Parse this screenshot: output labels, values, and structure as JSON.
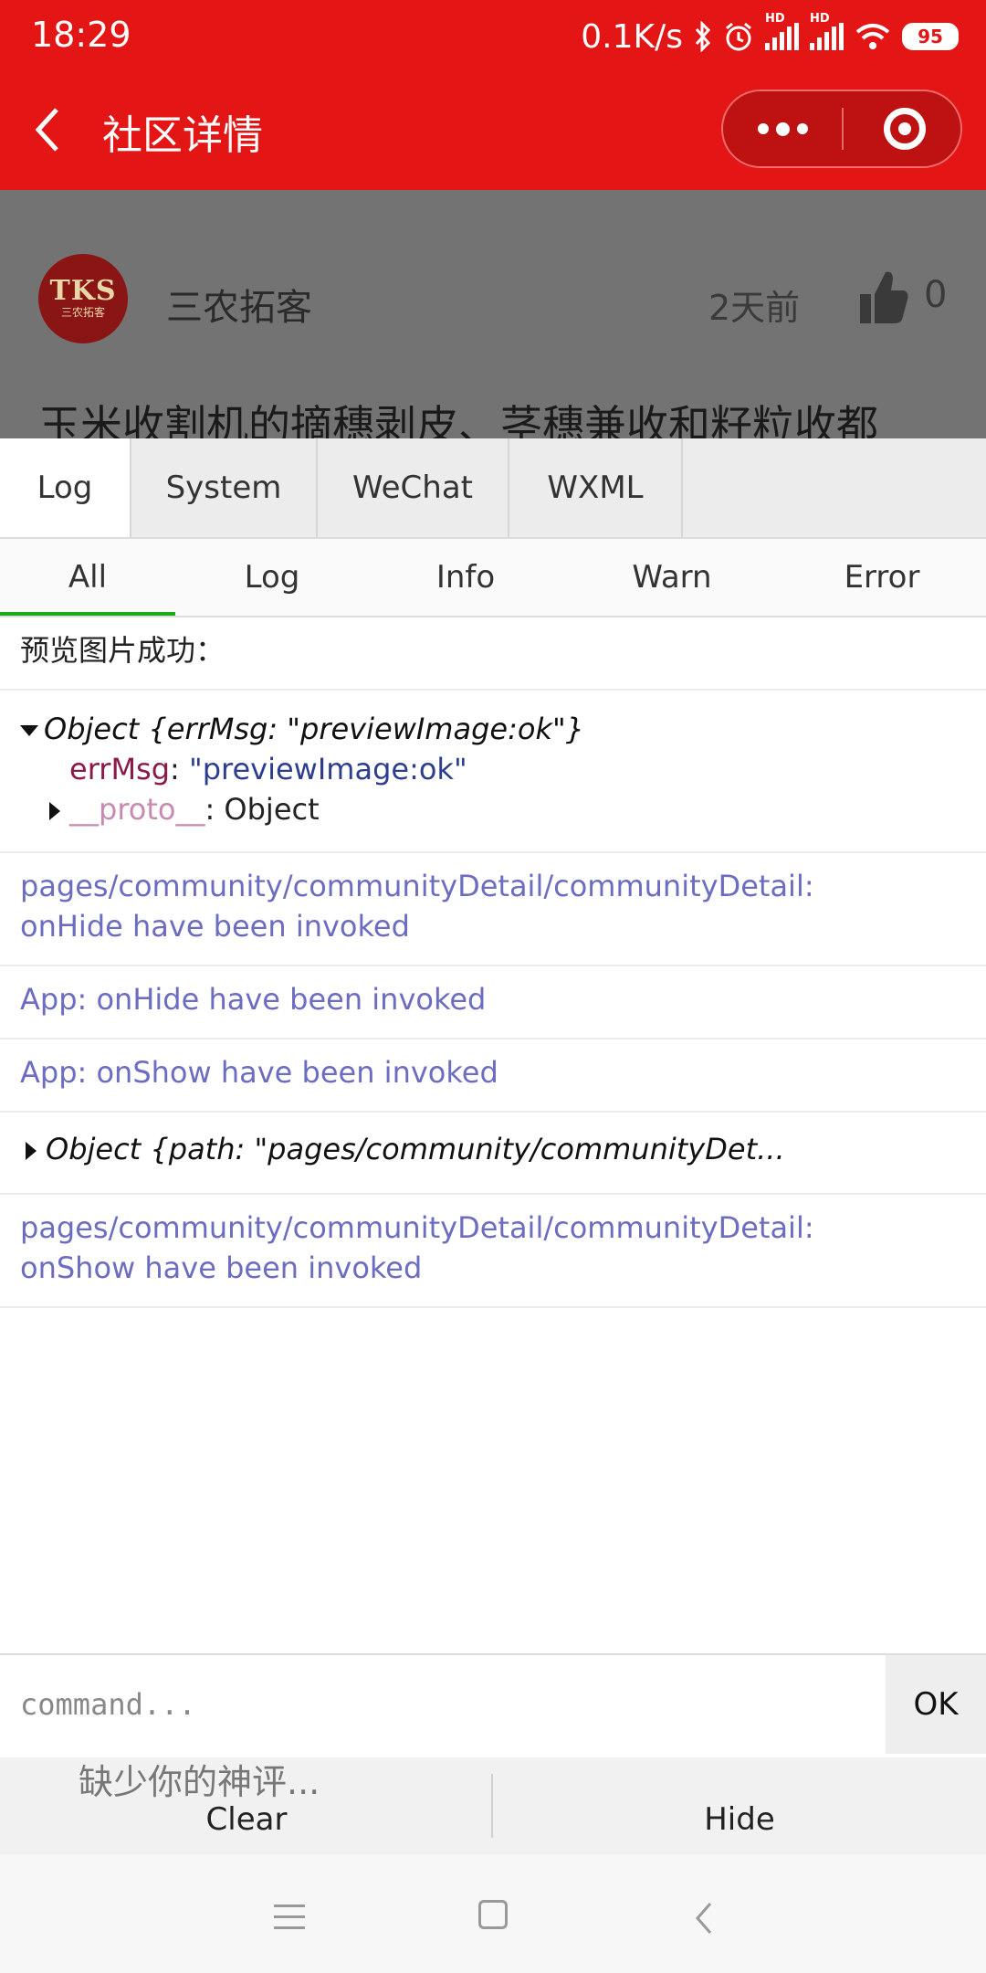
{
  "status_bar": {
    "time": "18:29",
    "net_speed": "0.1K/s",
    "signal_badge": "HD",
    "battery": "95"
  },
  "nav": {
    "title": "社区详情"
  },
  "post": {
    "avatar_text": "TKS",
    "avatar_sub": "三农拓客",
    "author": "三农拓客",
    "time_ago": "2天前",
    "likes": "0",
    "title": "玉米收割机的摘穗剥皮、茎穗兼收和籽粒收都"
  },
  "console": {
    "tabs": [
      "Log",
      "System",
      "WeChat",
      "WXML"
    ],
    "filters": [
      "All",
      "Log",
      "Info",
      "Warn",
      "Error"
    ],
    "logs": {
      "preview_msg": "预览图片成功：",
      "obj1_header": "Object {errMsg: \"previewImage:ok\"}",
      "obj1_key": "errMsg",
      "obj1_val": "\"previewImage:ok\"",
      "obj1_proto_key": "__proto__",
      "obj1_proto_val": ": Object",
      "hide_line1": "pages/community/communityDetail/communityDetail:",
      "hide_line2": "onHide have been invoked",
      "app_hide": "App: onHide have been invoked",
      "app_show": "App: onShow have been invoked",
      "obj2_header": "Object {path: \"pages/community/communityDet...",
      "show_line1": "pages/community/communityDetail/communityDetail:",
      "show_line2": "onShow have been invoked"
    },
    "command": {
      "placeholder": "command...",
      "ok_label": "OK"
    },
    "clear_label": "Clear",
    "hide_label": "Hide"
  },
  "comment_placeholder": "缺少你的神评...",
  "colors": {
    "nav_red": "#e41515",
    "sys_log": "#6c6cc1",
    "active_underline": "#1aad19"
  }
}
